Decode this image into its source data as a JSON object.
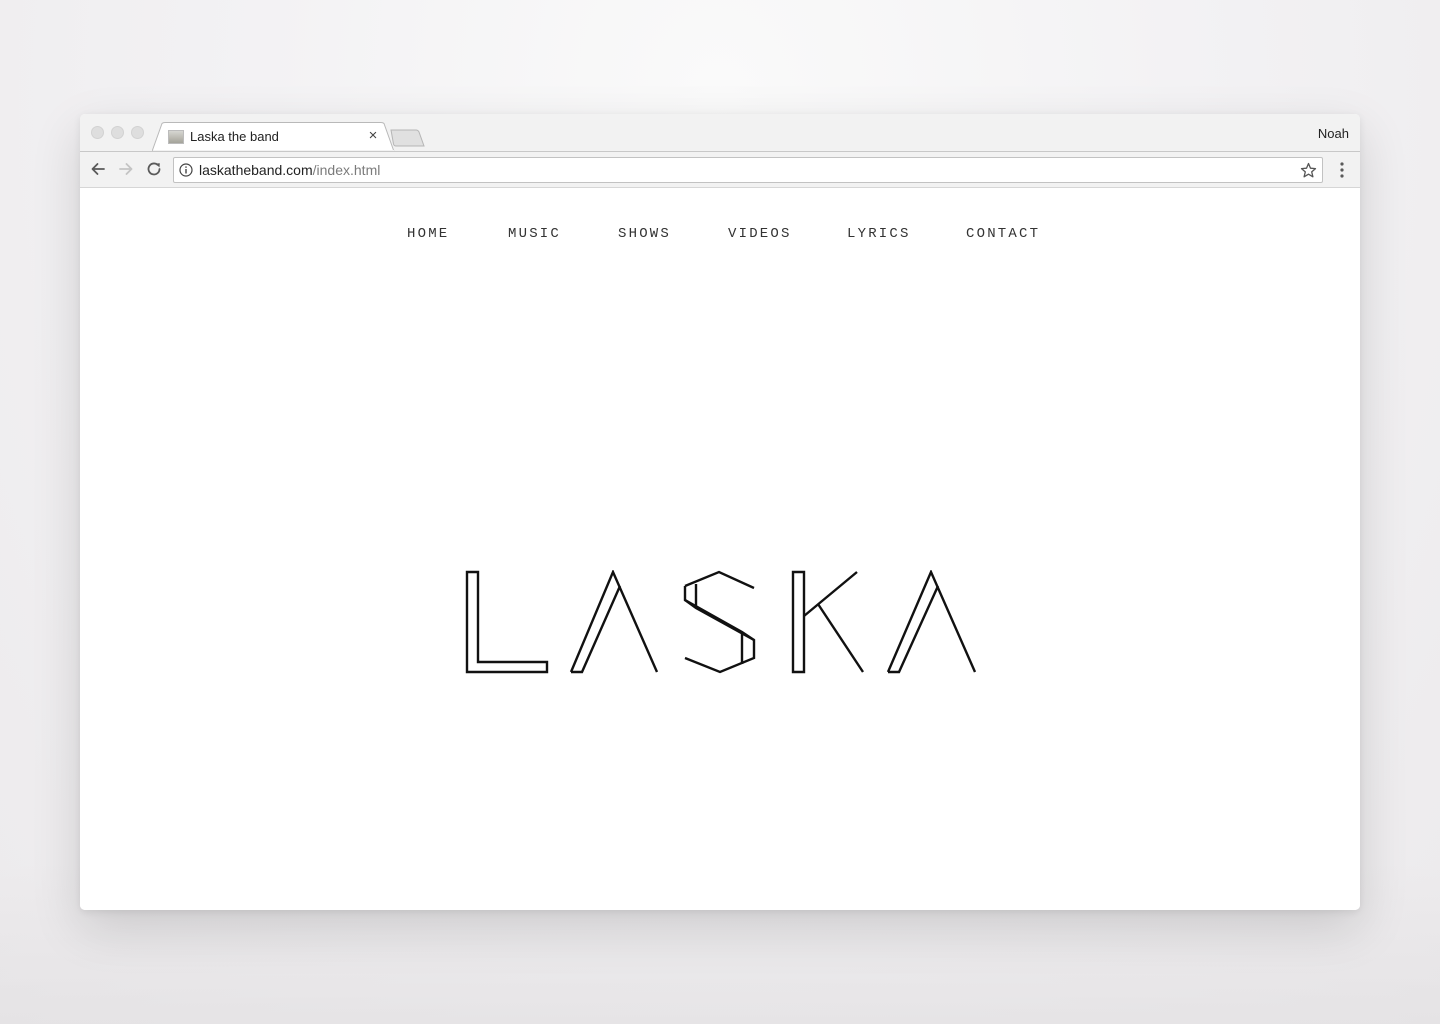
{
  "browser": {
    "tab_title": "Laska the band",
    "tab_close_glyph": "×",
    "profile_name": "Noah",
    "url_host": "laskatheband.com",
    "url_path": "/index.html",
    "icons": [
      "back-arrow-icon",
      "forward-arrow-icon",
      "reload-icon",
      "info-icon",
      "star-icon",
      "menu-dots-icon",
      "favicon-icon"
    ]
  },
  "site": {
    "nav": [
      "HOME",
      "MUSIC",
      "SHOWS",
      "VIDEOS",
      "LYRICS",
      "CONTACT"
    ],
    "logo_text": "LASKA"
  }
}
